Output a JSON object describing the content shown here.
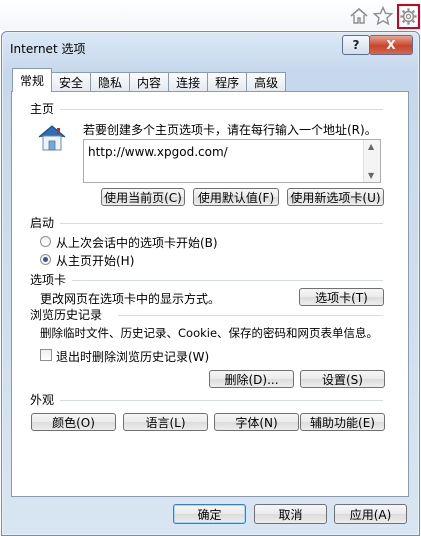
{
  "dialog": {
    "title": "Internet 选项",
    "help_label": "?",
    "close_label": "X"
  },
  "tabs": [
    {
      "label": "常规",
      "active": true
    },
    {
      "label": "安全"
    },
    {
      "label": "隐私"
    },
    {
      "label": "内容"
    },
    {
      "label": "连接"
    },
    {
      "label": "程序"
    },
    {
      "label": "高级"
    }
  ],
  "home": {
    "section_label": "主页",
    "instruction": "若要创建多个主页选项卡，请在每行输入一个地址(R)。",
    "url_value": "http://www.xpgod.com/",
    "use_current": "使用当前页(C)",
    "use_default": "使用默认值(F)",
    "use_new_tab": "使用新选项卡(U)"
  },
  "startup": {
    "section_label": "启动",
    "option_last": "从上次会话中的选项卡开始(B)",
    "option_home": "从主页开始(H)",
    "selected": "option_home"
  },
  "tabs_section": {
    "section_label": "选项卡",
    "description": "更改网页在选项卡中的显示方式。",
    "button": "选项卡(T)"
  },
  "history": {
    "section_label": "浏览历史记录",
    "description": "删除临时文件、历史记录、Cookie、保存的密码和网页表单信息。",
    "checkbox_label": "退出时删除浏览历史记录(W)",
    "checked": false,
    "delete_button": "删除(D)...",
    "settings_button": "设置(S)"
  },
  "appearance": {
    "section_label": "外观",
    "colors": "颜色(O)",
    "languages": "语言(L)",
    "fonts": "字体(N)",
    "accessibility": "辅助功能(E)"
  },
  "footer": {
    "ok": "确定",
    "cancel": "取消",
    "apply": "应用(A)"
  },
  "icons": {
    "toolbar": [
      "home-icon",
      "star-icon",
      "gear-icon"
    ],
    "home_section": "house-icon"
  },
  "colors": {
    "highlight_border": "#d0021b",
    "close_button": "#c7452a"
  }
}
